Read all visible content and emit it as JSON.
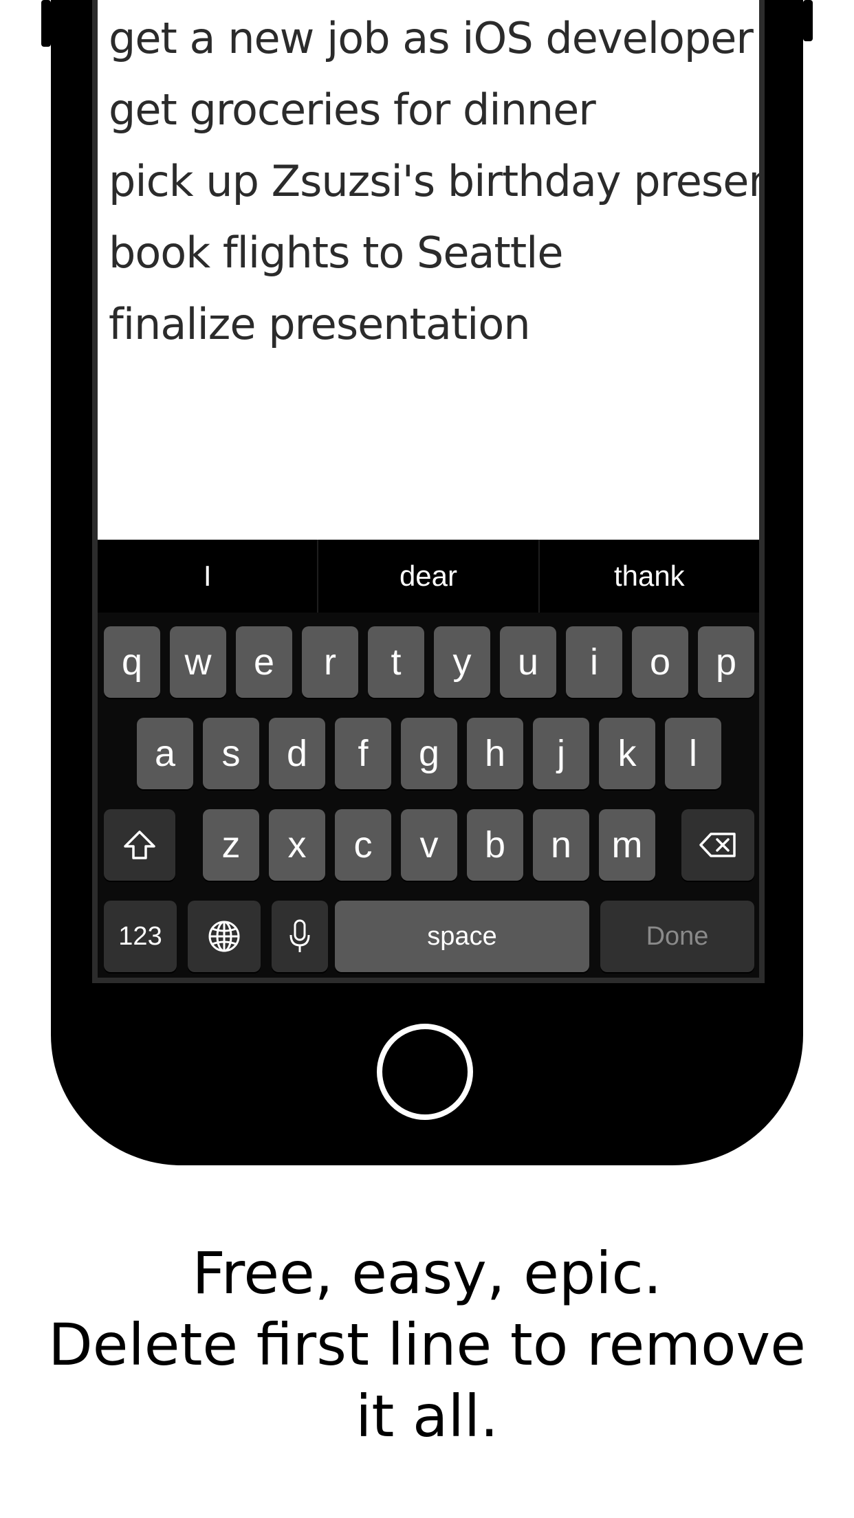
{
  "note": {
    "lines": [
      "get a new job as iOS developer",
      "get groceries for dinner",
      "pick up Zsuzsi's birthday present",
      "book flights to Seattle",
      "finalize presentation"
    ]
  },
  "suggestions": [
    "I",
    "dear",
    "thank"
  ],
  "keyboard": {
    "row1": [
      "q",
      "w",
      "e",
      "r",
      "t",
      "y",
      "u",
      "i",
      "o",
      "p"
    ],
    "row2": [
      "a",
      "s",
      "d",
      "f",
      "g",
      "h",
      "j",
      "k",
      "l"
    ],
    "row3": [
      "z",
      "x",
      "c",
      "v",
      "b",
      "n",
      "m"
    ],
    "numbers_label": "123",
    "space_label": "space",
    "done_label": "Done",
    "icons": [
      "shift-icon",
      "delete-icon",
      "globe-icon",
      "microphone-icon"
    ]
  },
  "caption": {
    "line1": "Free, easy, epic.",
    "line2": "Delete first line to remove it all."
  },
  "colors": {
    "phone_body": "#000000",
    "key": "#595959",
    "key_dark": "#303030",
    "done_text": "#8a8a8a"
  }
}
